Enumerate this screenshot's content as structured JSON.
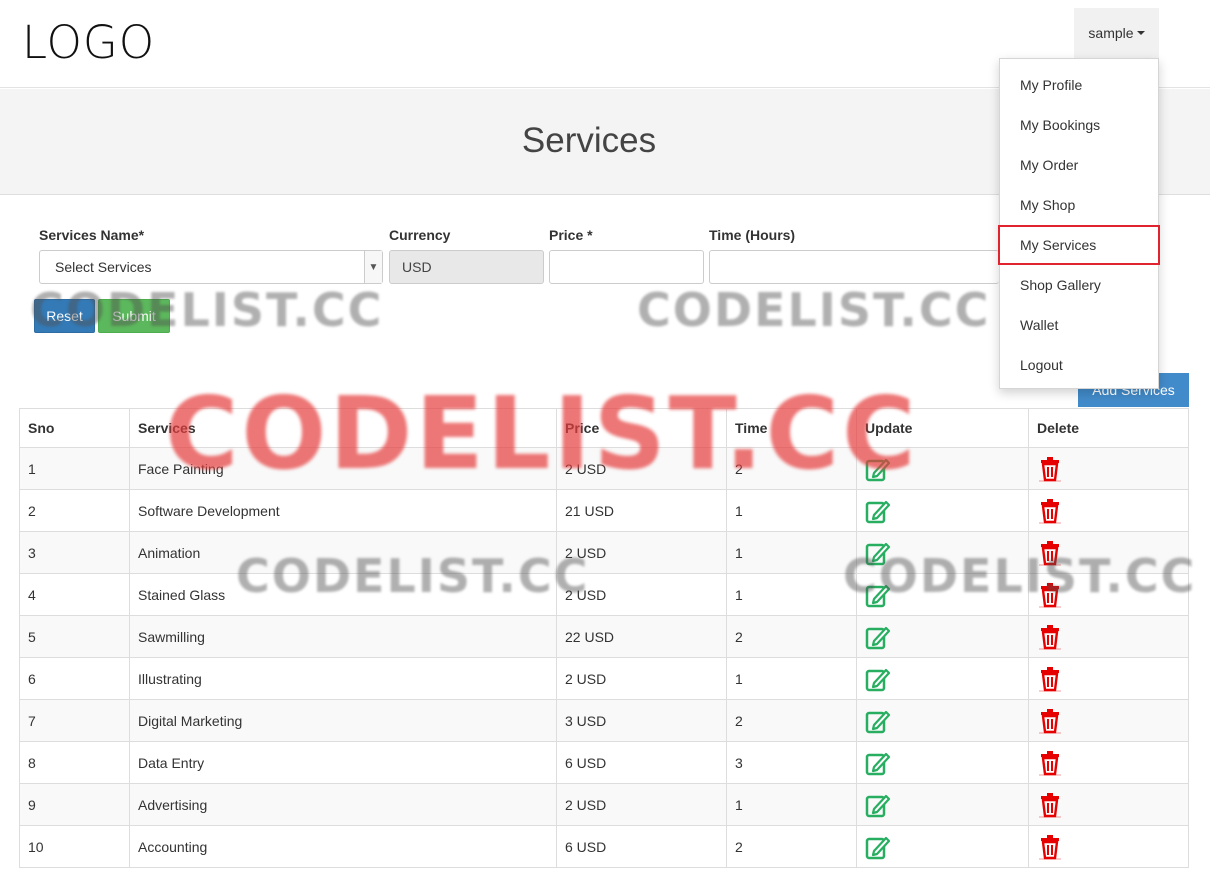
{
  "header": {
    "logo": "LOGO",
    "user_menu_label": "sample"
  },
  "page": {
    "title": "Services"
  },
  "form": {
    "services_name_label": "Services Name*",
    "services_select_value": "Select Services",
    "currency_label": "Currency",
    "currency_value": "USD",
    "price_label": "Price *",
    "time_label": "Time (Hours)",
    "reset_label": "Reset",
    "submit_label": "Submit",
    "add_services_label": "Add Services"
  },
  "table": {
    "headers": [
      "Sno",
      "Services",
      "Price",
      "Time",
      "Update",
      "Delete"
    ],
    "rows": [
      {
        "sno": "1",
        "service": "Face Painting",
        "price": "2 USD",
        "time": "2"
      },
      {
        "sno": "2",
        "service": "Software Development",
        "price": "21 USD",
        "time": "1"
      },
      {
        "sno": "3",
        "service": "Animation",
        "price": "2 USD",
        "time": "1"
      },
      {
        "sno": "4",
        "service": "Stained Glass",
        "price": "2 USD",
        "time": "1"
      },
      {
        "sno": "5",
        "service": "Sawmilling",
        "price": "22 USD",
        "time": "2"
      },
      {
        "sno": "6",
        "service": "Illustrating",
        "price": "2 USD",
        "time": "1"
      },
      {
        "sno": "7",
        "service": "Digital Marketing",
        "price": "3 USD",
        "time": "2"
      },
      {
        "sno": "8",
        "service": "Data Entry",
        "price": "6 USD",
        "time": "3"
      },
      {
        "sno": "9",
        "service": "Advertising",
        "price": "2 USD",
        "time": "1"
      },
      {
        "sno": "10",
        "service": "Accounting",
        "price": "6 USD",
        "time": "2"
      }
    ]
  },
  "dropdown": {
    "items": [
      {
        "label": "My Profile"
      },
      {
        "label": "My Bookings"
      },
      {
        "label": "My Order"
      },
      {
        "label": "My Shop"
      },
      {
        "label": "My Services"
      },
      {
        "label": "Shop Gallery"
      },
      {
        "label": "Wallet"
      },
      {
        "label": "Logout"
      }
    ]
  },
  "watermark": {
    "text": "CODELIST.CC"
  },
  "colors": {
    "update_icon": "#27ae60",
    "delete_icon": "#e60000",
    "reset_button": "#337ab7",
    "submit_button": "#5cb85c",
    "add_button": "#428bca",
    "active_menu_border": "#e0232f"
  },
  "icons": {
    "update": "edit-icon",
    "delete": "trash-icon"
  }
}
